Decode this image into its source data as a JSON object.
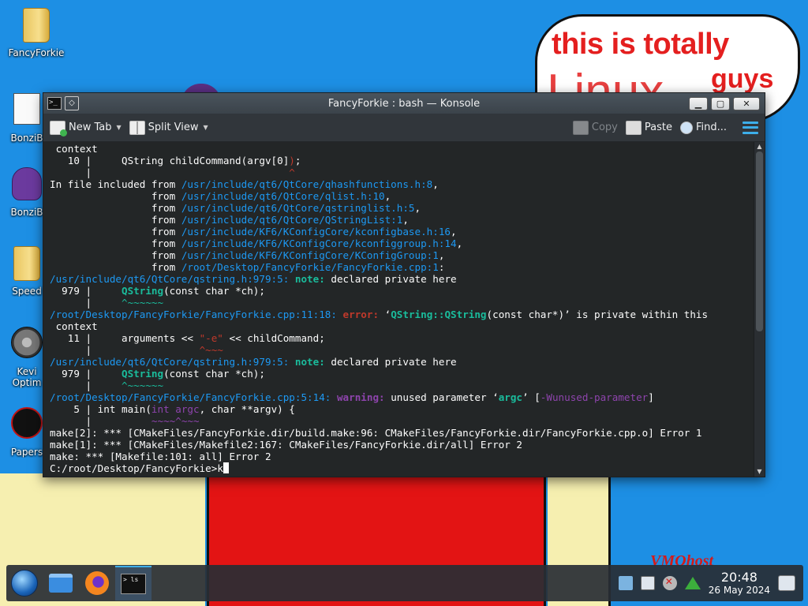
{
  "desktop": {
    "icons": [
      {
        "label": "FancyForkie",
        "icon": "folder-icon"
      },
      {
        "label": "BonziB",
        "icon": "file-icon"
      },
      {
        "label": "BonziB",
        "icon": "bonzi-icon"
      },
      {
        "label": "Speed",
        "icon": "folder-icon"
      },
      {
        "label": "Kevi",
        "icon": "disc-icon"
      },
      {
        "label": "Optim",
        "icon": ""
      },
      {
        "label": "Papers",
        "icon": "papers-icon"
      }
    ],
    "meme": {
      "line1": "this is totally",
      "big": "Linux",
      "guys": "guys",
      "scrawl": "VMOhost"
    }
  },
  "window": {
    "title": "FancyForkie : bash — Konsole",
    "controls": {
      "minimize": "▁",
      "maximize": "▢",
      "close": "✕"
    },
    "toolbar": {
      "new_tab": "New Tab",
      "split_view": "Split View",
      "copy": "Copy",
      "paste": "Paste",
      "find": "Find..."
    }
  },
  "terminal": {
    "lines": [
      [
        {
          "t": " context"
        }
      ],
      [
        {
          "t": "   10 |     QString childCommand(argv[0]"
        },
        {
          "t": ")",
          "c": "c-err"
        },
        {
          "t": ";"
        }
      ],
      [
        {
          "t": "      |                                 "
        },
        {
          "t": "^",
          "c": "c-caret"
        }
      ],
      [
        {
          "t": "In file included from "
        },
        {
          "t": "/usr/include/qt6/QtCore/qhashfunctions.h:8",
          "c": "c-path"
        },
        {
          "t": ","
        }
      ],
      [
        {
          "t": "                 from "
        },
        {
          "t": "/usr/include/qt6/QtCore/qlist.h:10",
          "c": "c-path"
        },
        {
          "t": ","
        }
      ],
      [
        {
          "t": "                 from "
        },
        {
          "t": "/usr/include/qt6/QtCore/qstringlist.h:5",
          "c": "c-path"
        },
        {
          "t": ","
        }
      ],
      [
        {
          "t": "                 from "
        },
        {
          "t": "/usr/include/qt6/QtCore/QStringList:1",
          "c": "c-path"
        },
        {
          "t": ","
        }
      ],
      [
        {
          "t": "                 from "
        },
        {
          "t": "/usr/include/KF6/KConfigCore/kconfigbase.h:16",
          "c": "c-path"
        },
        {
          "t": ","
        }
      ],
      [
        {
          "t": "                 from "
        },
        {
          "t": "/usr/include/KF6/KConfigCore/kconfiggroup.h:14",
          "c": "c-path"
        },
        {
          "t": ","
        }
      ],
      [
        {
          "t": "                 from "
        },
        {
          "t": "/usr/include/KF6/KConfigCore/KConfigGroup:1",
          "c": "c-path"
        },
        {
          "t": ","
        }
      ],
      [
        {
          "t": "                 from "
        },
        {
          "t": "/root/Desktop/FancyForkie/FancyForkie.cpp:1",
          "c": "c-path"
        },
        {
          "t": ":"
        }
      ],
      [
        {
          "t": "/usr/include/qt6/QtCore/qstring.h:979:5: ",
          "c": "c-path"
        },
        {
          "t": "note:",
          "c": "c-note"
        },
        {
          "t": " declared private here"
        }
      ],
      [
        {
          "t": "  979 |     "
        },
        {
          "t": "QString",
          "c": "c-hl"
        },
        {
          "t": "(const char *ch);"
        }
      ],
      [
        {
          "t": "      |     "
        },
        {
          "t": "^~~~~~~",
          "c": "c-greencaret"
        }
      ],
      [
        {
          "t": "/root/Desktop/FancyForkie/FancyForkie.cpp:11:18: ",
          "c": "c-path"
        },
        {
          "t": "error:",
          "c": "c-error"
        },
        {
          "t": " ‘"
        },
        {
          "t": "QString::QString",
          "c": "c-hl"
        },
        {
          "t": "(const char*)’ is private within this"
        }
      ],
      [
        {
          "t": " context"
        }
      ],
      [
        {
          "t": "   11 |     arguments << "
        },
        {
          "t": "\"-e\"",
          "c": "c-err"
        },
        {
          "t": " << childCommand;"
        }
      ],
      [
        {
          "t": "      |                  "
        },
        {
          "t": "^~~~",
          "c": "c-caret"
        }
      ],
      [
        {
          "t": "/usr/include/qt6/QtCore/qstring.h:979:5: ",
          "c": "c-path"
        },
        {
          "t": "note:",
          "c": "c-note"
        },
        {
          "t": " declared private here"
        }
      ],
      [
        {
          "t": "  979 |     "
        },
        {
          "t": "QString",
          "c": "c-hl"
        },
        {
          "t": "(const char *ch);"
        }
      ],
      [
        {
          "t": "      |     "
        },
        {
          "t": "^~~~~~~",
          "c": "c-greencaret"
        }
      ],
      [
        {
          "t": "/root/Desktop/FancyForkie/FancyForkie.cpp:5:14: ",
          "c": "c-path"
        },
        {
          "t": "warning:",
          "c": "c-warn"
        },
        {
          "t": " unused parameter ‘"
        },
        {
          "t": "argc",
          "c": "c-hl"
        },
        {
          "t": "’ ["
        },
        {
          "t": "-Wunused-parameter",
          "c": "c-purple"
        },
        {
          "t": "]"
        }
      ],
      [
        {
          "t": "    5 | int main("
        },
        {
          "t": "int argc",
          "c": "c-purple"
        },
        {
          "t": ", char **argv) {"
        }
      ],
      [
        {
          "t": "      |          "
        },
        {
          "t": "~~~~^~~~",
          "c": "c-purplecaret"
        }
      ],
      [
        {
          "t": "make[2]: *** [CMakeFiles/FancyForkie.dir/build.make:96: CMakeFiles/FancyForkie.dir/FancyForkie.cpp.o] Error 1"
        }
      ],
      [
        {
          "t": "make[1]: *** [CMakeFiles/Makefile2:167: CMakeFiles/FancyForkie.dir/all] Error 2"
        }
      ],
      [
        {
          "t": "make: *** [Makefile:101: all] Error 2"
        }
      ]
    ],
    "prompt": "C:/root/Desktop/FancyForkie>",
    "input": "k"
  },
  "taskbar": {
    "konsole_preview": "> ls",
    "clock_time": "20:48",
    "clock_date": "26 May 2024"
  }
}
